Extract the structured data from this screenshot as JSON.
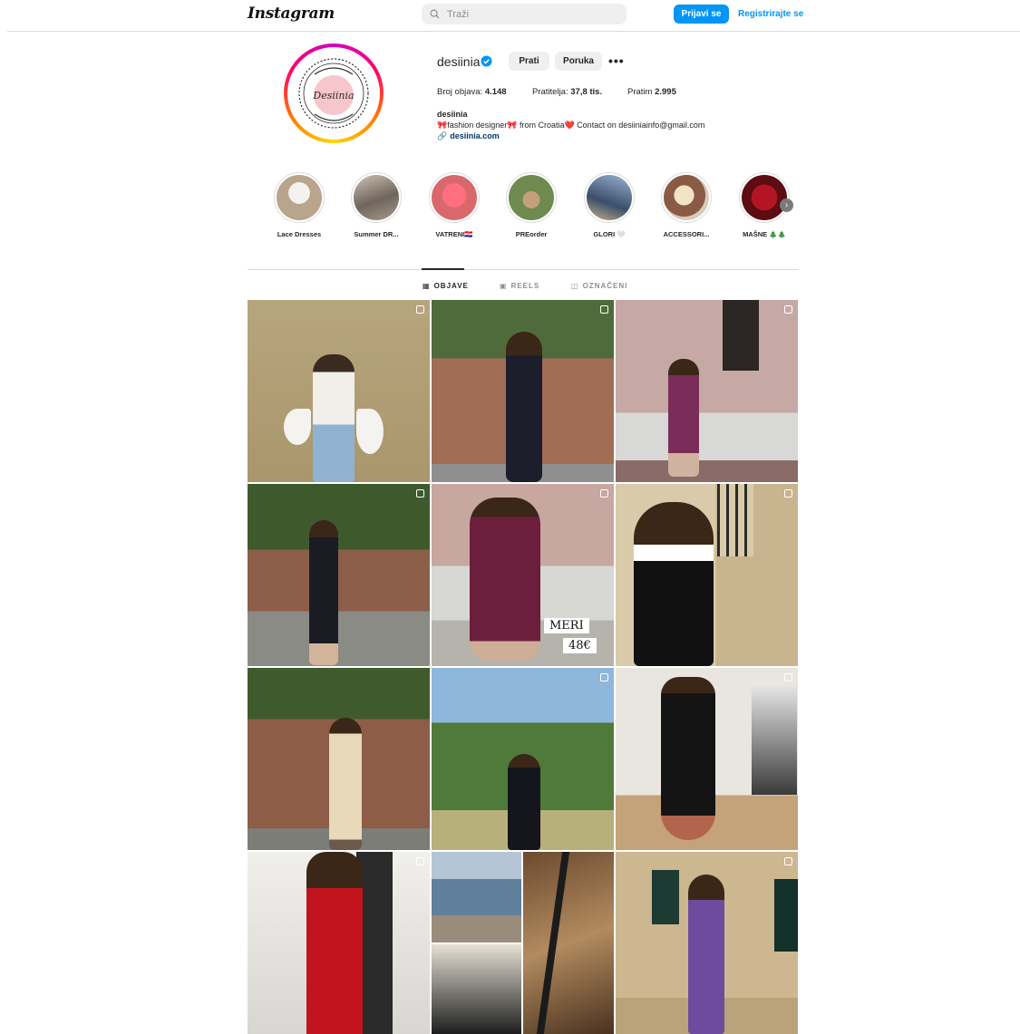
{
  "header": {
    "logo": "Instagram",
    "search_placeholder": "Traži",
    "login_label": "Prijavi se",
    "register_label": "Registrirajte se"
  },
  "profile": {
    "avatar_text": "Desiinia",
    "username": "desiinia",
    "follow_label": "Prati",
    "message_label": "Poruka",
    "more_label": "•••",
    "stats": {
      "posts_label": "Broj objava: ",
      "posts_value": "4.148",
      "followers_label": "Pratitelja: ",
      "followers_value": "37,8 tis.",
      "following_label": "Pratim ",
      "following_value": "2.995"
    },
    "bio_name": "desiinia",
    "bio_text": "🎀fashion designer🎀 from Croatia❤️ Contact on desiiniainfo@gmail.com",
    "link_icon": "🔗",
    "link": "desiinia.com"
  },
  "highlights": [
    {
      "label": "Lace Dresses"
    },
    {
      "label": "Summer DR..."
    },
    {
      "label": "VATRENI🇭🇷"
    },
    {
      "label": "PREorder"
    },
    {
      "label": "GLORI 🤍"
    },
    {
      "label": "ACCESSORI..."
    },
    {
      "label": "MAŠNE 🎄🎄"
    }
  ],
  "tabs": [
    {
      "label": "OBJAVE",
      "icon": "▦"
    },
    {
      "label": "REELS",
      "icon": "▣"
    },
    {
      "label": "OZNAČENI",
      "icon": "◫"
    }
  ],
  "post_overlay": {
    "name": "MERI",
    "price": "48€"
  },
  "colors": {
    "accent": "#0095f6",
    "verified": "#0095f6",
    "text": "#262626",
    "muted": "#8e8e8e"
  }
}
